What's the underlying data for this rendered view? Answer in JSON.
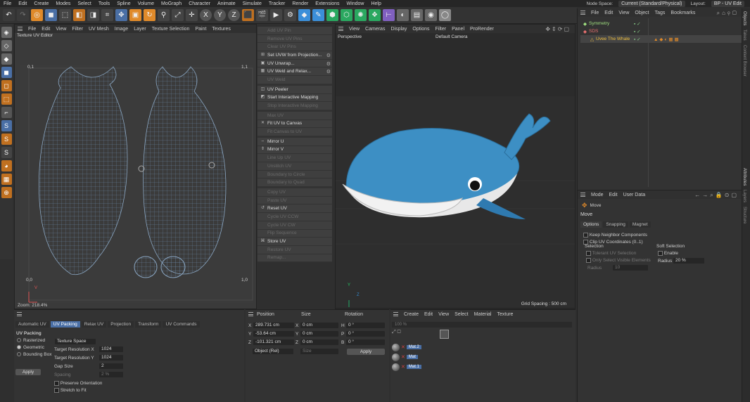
{
  "menubar": {
    "items": [
      "File",
      "Edit",
      "Create",
      "Modes",
      "Select",
      "Tools",
      "Spline",
      "Volume",
      "MoGraph",
      "Character",
      "Animate",
      "Simulate",
      "Tracker",
      "Render",
      "Extensions",
      "Window",
      "Help"
    ],
    "node_space_label": "Node Space:",
    "node_space_value": "Current (Standard/Physical)",
    "layout_label": "Layout:",
    "layout_value": "BP - UV Edit"
  },
  "uv_editor": {
    "menus": [
      "File",
      "Edit",
      "View",
      "Filter",
      "UV Mesh",
      "Image",
      "Layer",
      "Texture Selection",
      "Paint",
      "Textures"
    ],
    "title": "Texture UV Editor",
    "corner_tl": "0,1",
    "corner_tr": "1,1",
    "corner_bl": "0,0",
    "corner_br": "1,0",
    "zoom": "Zoom: 218.4%",
    "axis_u": "U",
    "axis_v": "V"
  },
  "uv_menu": {
    "items": [
      {
        "label": "Add UV Pin",
        "enabled": false,
        "icon": ""
      },
      {
        "label": "Remove UV Pins",
        "enabled": false,
        "icon": ""
      },
      {
        "label": "Clear UV Pins",
        "enabled": false,
        "icon": ""
      },
      {
        "label": "Set UVW from Projection...",
        "enabled": true,
        "icon": "⊞",
        "gear": true
      },
      {
        "label": "UV Unwrap...",
        "enabled": true,
        "icon": "▣",
        "gear": true
      },
      {
        "label": "UV Weld and Relax...",
        "enabled": true,
        "icon": "▦",
        "gear": true
      },
      {
        "label": "UV Weld",
        "enabled": false,
        "icon": ""
      },
      {
        "sep": true
      },
      {
        "label": "UV Peeler",
        "enabled": true,
        "icon": "◫"
      },
      {
        "label": "Start Interactive Mapping",
        "enabled": true,
        "icon": "◩"
      },
      {
        "label": "Stop Interactive Mapping",
        "enabled": false,
        "icon": ""
      },
      {
        "sep": true
      },
      {
        "label": "Max UV",
        "enabled": false,
        "icon": ""
      },
      {
        "label": "Fit UV to Canvas",
        "enabled": true,
        "icon": "✕"
      },
      {
        "label": "Fit Canvas to UV",
        "enabled": false,
        "icon": ""
      },
      {
        "sep": true
      },
      {
        "label": "Mirror U",
        "enabled": true,
        "icon": "⇔"
      },
      {
        "label": "Mirror V",
        "enabled": true,
        "icon": "⇕"
      },
      {
        "label": "Line Up UV",
        "enabled": false,
        "icon": ""
      },
      {
        "label": "Unstitch UV",
        "enabled": false,
        "icon": ""
      },
      {
        "label": "Boundary to Circle",
        "enabled": false,
        "icon": ""
      },
      {
        "label": "Boundary to Quad",
        "enabled": false,
        "icon": ""
      },
      {
        "sep": true
      },
      {
        "label": "Copy UV",
        "enabled": false,
        "icon": ""
      },
      {
        "label": "Paste UV",
        "enabled": false,
        "icon": ""
      },
      {
        "label": "Reset UV",
        "enabled": true,
        "icon": "↺"
      },
      {
        "label": "Cycle UV CCW",
        "enabled": false,
        "icon": ""
      },
      {
        "label": "Cycle UV CW",
        "enabled": false,
        "icon": ""
      },
      {
        "label": "Flip Sequence",
        "enabled": false,
        "icon": ""
      },
      {
        "label": "Store UV",
        "enabled": true,
        "icon": "⌘"
      },
      {
        "label": "Restore UV",
        "enabled": false,
        "icon": ""
      },
      {
        "label": "Remap...",
        "enabled": false,
        "icon": ""
      }
    ]
  },
  "viewport": {
    "menus": [
      "View",
      "Cameras",
      "Display",
      "Options",
      "Filter",
      "Panel",
      "ProRender"
    ],
    "label": "Perspective",
    "camera": "Default Camera",
    "grid": "Grid Spacing : 500 cm",
    "axis_y": "Y",
    "axis_z": "Z"
  },
  "object_manager": {
    "menus": [
      "File",
      "Edit",
      "View",
      "Object",
      "Tags",
      "Bookmarks"
    ],
    "objects": [
      {
        "name": "Symmetry",
        "color": "#9fdf7f"
      },
      {
        "name": "SDS",
        "color": "#e87070"
      },
      {
        "name": "Uvee The Whale",
        "color": "#f0c040"
      }
    ],
    "side_tabs": [
      "Objects",
      "Takes",
      "Content Browser"
    ]
  },
  "attributes": {
    "menus": [
      "Mode",
      "Edit",
      "User Data"
    ],
    "tool_name": "Move",
    "section_title": "Move",
    "tabs": [
      "Options",
      "Snapping",
      "Magnet"
    ],
    "keep_neighbor": "Keep Neighbor Components",
    "clip_uv": "Clip UV Coordinates (0..1)",
    "selection_title": "Selection",
    "tolerant": "Tolerant UV Selection",
    "only_visible": "Only Select Visible Elements",
    "radius_label": "Radius",
    "radius_value": "10",
    "soft_title": "Soft Selection",
    "enable_label": "Enable",
    "soft_radius_label": "Radius",
    "soft_radius_value": "20 %",
    "side_tabs": [
      "Attributes",
      "Layers",
      "Structure"
    ]
  },
  "uv_commands": {
    "tabs": [
      "Automatic UV",
      "UV Packing",
      "Relax UV",
      "Projection",
      "Transform",
      "UV Commands"
    ],
    "active_tab": "UV Packing",
    "section": "UV Packing",
    "methods": [
      "Rasterized",
      "Geometric",
      "Bounding Box"
    ],
    "selected_method": "Geometric",
    "texture_space": "Texture Space",
    "res_x_label": "Target Resolution X",
    "res_x": "1024",
    "res_y_label": "Target Resolution Y",
    "res_y": "1024",
    "gap_label": "Gap Size",
    "gap": "2",
    "spacing_label": "Spacing",
    "spacing": "2 %",
    "apply": "Apply",
    "preserve": "Preserve Orientation",
    "stretch": "Stretch to Fit"
  },
  "coordinates": {
    "headers": [
      "Position",
      "Size",
      "Rotation"
    ],
    "rows": [
      {
        "axis": "X",
        "pos": "289.731 cm",
        "saxis": "X",
        "size": "0 cm",
        "raxis": "H",
        "rot": "0 °"
      },
      {
        "axis": "Y",
        "pos": "-53.64 cm",
        "saxis": "Y",
        "size": "0 cm",
        "raxis": "P",
        "rot": "0 °"
      },
      {
        "axis": "Z",
        "pos": "-101.321 cm",
        "saxis": "Z",
        "size": "0 cm",
        "raxis": "B",
        "rot": "0 °"
      }
    ],
    "mode": "Object (Rel)",
    "size_mode": "Size",
    "apply": "Apply"
  },
  "materials": {
    "menus": [
      "Create",
      "Edit",
      "View",
      "Select",
      "Material",
      "Texture"
    ],
    "zoom": "100 %",
    "items": [
      "Mat.2",
      "Mat",
      "Mat.1"
    ]
  }
}
